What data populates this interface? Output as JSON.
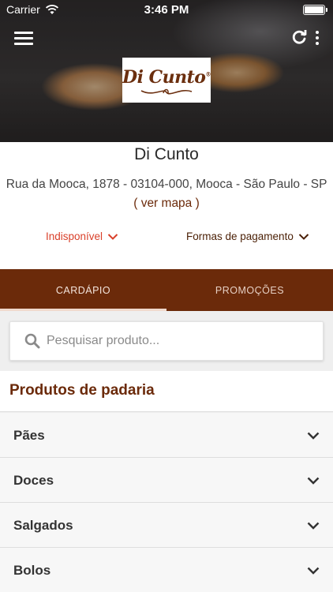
{
  "status_bar": {
    "carrier": "Carrier",
    "time": "3:46 PM",
    "battery_level": 1.0
  },
  "header": {
    "menu_icon": "hamburger-menu-icon",
    "refresh_icon": "refresh-icon",
    "more_icon": "vertical-dots-icon"
  },
  "logo": {
    "text": "Di Cunto",
    "registered": "®"
  },
  "store": {
    "name": "Di Cunto",
    "address": "Rua da Mooca, 1878 - 03104-000, Mooca - São Paulo - SP",
    "map_open": "(",
    "map_link": "ver mapa",
    "map_close": ")",
    "status": "Indisponível",
    "payment": "Formas de pagamento"
  },
  "tabs": [
    {
      "label": "CARDÁPIO",
      "active": true
    },
    {
      "label": "PROMOÇÕES",
      "active": false
    }
  ],
  "search": {
    "placeholder": "Pesquisar produto...",
    "value": ""
  },
  "section": {
    "title": "Produtos de padaria",
    "items": [
      {
        "label": "Pães"
      },
      {
        "label": "Doces"
      },
      {
        "label": "Salgados"
      },
      {
        "label": "Bolos"
      }
    ]
  },
  "colors": {
    "brand": "#6b2a0a",
    "status_unavailable": "#d9402a",
    "tab_underline": "#f0d9cd"
  }
}
